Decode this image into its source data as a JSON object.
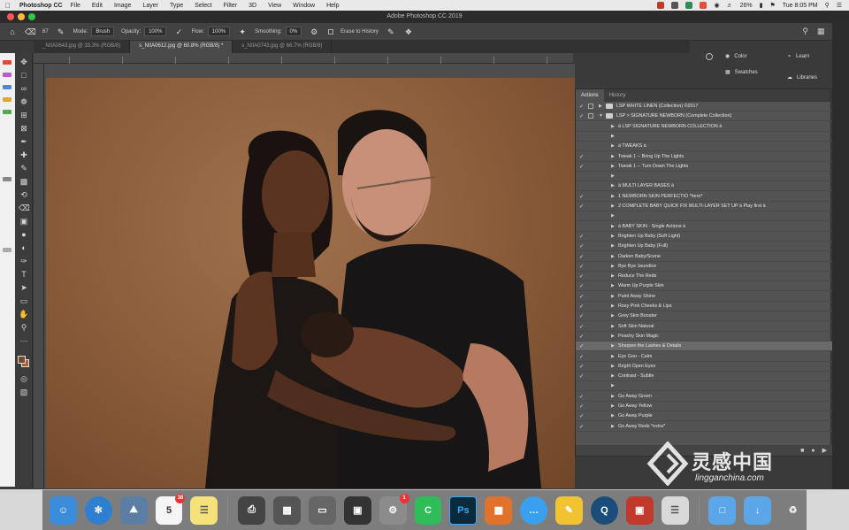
{
  "menubar": {
    "apple": "",
    "app": "Photoshop CC",
    "items": [
      "File",
      "Edit",
      "Image",
      "Layer",
      "Type",
      "Select",
      "Filter",
      "3D",
      "View",
      "Window",
      "Help"
    ],
    "battery": "26%",
    "clock": "Tue 8:05 PM"
  },
  "titlebar": {
    "title": "Adobe Photoshop CC 2019"
  },
  "optionsbar": {
    "brush_size": "87",
    "mode_label": "Mode:",
    "mode_value": "Brush",
    "opacity_label": "Opacity:",
    "opacity_value": "100%",
    "flow_label": "Flow:",
    "flow_value": "100%",
    "smoothing_label": "Smoothing:",
    "smoothing_value": "0%",
    "erase_history": "Erase to History"
  },
  "tabs": [
    {
      "label": "_NIIA0643.jpg @ 33.3% (RGB/8)",
      "active": false
    },
    {
      "label": "s_NIIA0612.jpg @ 60.8% (RGB/8) *",
      "active": true
    },
    {
      "label": "s_NIIA0743.jpg @ 66.7% (RGB/8)",
      "active": false
    }
  ],
  "minipanels": {
    "color": "Color",
    "swatches": "Swatches",
    "learn": "Learn",
    "libraries": "Libraries"
  },
  "actions_panel": {
    "tabs": [
      "Actions",
      "History"
    ],
    "rows": [
      {
        "check": true,
        "box": true,
        "level": 0,
        "folder": true,
        "text": "LSP WHITE LINEN   (Collection) ©2017",
        "hl": false
      },
      {
        "check": true,
        "box": true,
        "level": 0,
        "folder": true,
        "text": "LSP > SIGNATURE NEWBORN (Complete Collection)",
        "hl": false
      },
      {
        "check": false,
        "box": false,
        "level": 1,
        "folder": false,
        "text": "à LSP SIGNATURE NEWBORN COLLECTION à",
        "hl": false
      },
      {
        "check": false,
        "box": false,
        "level": 1,
        "folder": false,
        "text": "",
        "hl": false
      },
      {
        "check": false,
        "box": false,
        "level": 1,
        "folder": false,
        "text": "à TWEAKS à",
        "hl": false
      },
      {
        "check": true,
        "box": false,
        "level": 1,
        "folder": false,
        "text": "Tweak 1 -- Bring Up The Lights",
        "hl": false
      },
      {
        "check": true,
        "box": false,
        "level": 1,
        "folder": false,
        "text": "Tweak 1 -- Turn Down The Lights",
        "hl": false
      },
      {
        "check": false,
        "box": false,
        "level": 1,
        "folder": false,
        "text": "",
        "hl": false
      },
      {
        "check": false,
        "box": false,
        "level": 1,
        "folder": false,
        "text": "à MULTI LAYER BASES à",
        "hl": false
      },
      {
        "check": true,
        "box": false,
        "level": 1,
        "folder": false,
        "text": "1  NEWBORN SKIN PERFECTIO *here*",
        "hl": false
      },
      {
        "check": true,
        "box": false,
        "level": 1,
        "folder": false,
        "text": "2  COMPLETE BABY QUICK FIX MULTI-LAYER SET UP à Play first à",
        "hl": false
      },
      {
        "check": false,
        "box": false,
        "level": 1,
        "folder": false,
        "text": "",
        "hl": false
      },
      {
        "check": false,
        "box": false,
        "level": 1,
        "folder": false,
        "text": "à BABY SKIN - Single Actions à",
        "hl": false
      },
      {
        "check": true,
        "box": false,
        "level": 1,
        "folder": false,
        "text": "Brighten Up Baby (Soft Light)",
        "hl": false
      },
      {
        "check": true,
        "box": false,
        "level": 1,
        "folder": false,
        "text": "Brighten Up Baby (Full)",
        "hl": false
      },
      {
        "check": true,
        "box": false,
        "level": 1,
        "folder": false,
        "text": "Darken Baby/Scene",
        "hl": false
      },
      {
        "check": true,
        "box": false,
        "level": 1,
        "folder": false,
        "text": "Bye Bye Jaundice",
        "hl": false
      },
      {
        "check": true,
        "box": false,
        "level": 1,
        "folder": false,
        "text": "Reduce The Reds",
        "hl": false
      },
      {
        "check": true,
        "box": false,
        "level": 1,
        "folder": false,
        "text": "Warm Up Purple Skin",
        "hl": false
      },
      {
        "check": true,
        "box": false,
        "level": 1,
        "folder": false,
        "text": "Paint Away Shine",
        "hl": false
      },
      {
        "check": true,
        "box": false,
        "level": 1,
        "folder": false,
        "text": "Rosy Pink Cheeks & Lips",
        "hl": false
      },
      {
        "check": true,
        "box": false,
        "level": 1,
        "folder": false,
        "text": "Grey Skin Booster",
        "hl": false
      },
      {
        "check": true,
        "box": false,
        "level": 1,
        "folder": false,
        "text": "Soft Skin Natural",
        "hl": false
      },
      {
        "check": true,
        "box": false,
        "level": 1,
        "folder": false,
        "text": "Peachy Skin Magic",
        "hl": false
      },
      {
        "check": true,
        "box": false,
        "level": 1,
        "folder": false,
        "text": "Sharpen the Lashes & Details",
        "hl": true
      },
      {
        "check": true,
        "box": false,
        "level": 1,
        "folder": false,
        "text": "Eye Goo - Calm",
        "hl": false
      },
      {
        "check": true,
        "box": false,
        "level": 1,
        "folder": false,
        "text": "Bright Open Eyes",
        "hl": false
      },
      {
        "check": true,
        "box": false,
        "level": 1,
        "folder": false,
        "text": "Contrast - Subtle",
        "hl": false
      },
      {
        "check": false,
        "box": false,
        "level": 1,
        "folder": false,
        "text": "",
        "hl": false
      },
      {
        "check": true,
        "box": false,
        "level": 1,
        "folder": false,
        "text": "Go Away Green",
        "hl": false
      },
      {
        "check": true,
        "box": false,
        "level": 1,
        "folder": false,
        "text": "Go Away Yellow",
        "hl": false
      },
      {
        "check": true,
        "box": false,
        "level": 1,
        "folder": false,
        "text": "Go Away Purple",
        "hl": false
      },
      {
        "check": true,
        "box": false,
        "level": 1,
        "folder": false,
        "text": "Go Away Reds *extra*",
        "hl": false
      }
    ]
  },
  "dock": {
    "calendar_day": "5",
    "calendar_badge": "38",
    "settings_badge": "1",
    "ps_label": "Ps"
  },
  "watermark": {
    "cn": "灵感中国",
    "en": "lingganchina.com"
  },
  "colors": {
    "backdrop": "#9a6a48",
    "panel": "#535353",
    "ps_blue": "#31a8ff"
  }
}
